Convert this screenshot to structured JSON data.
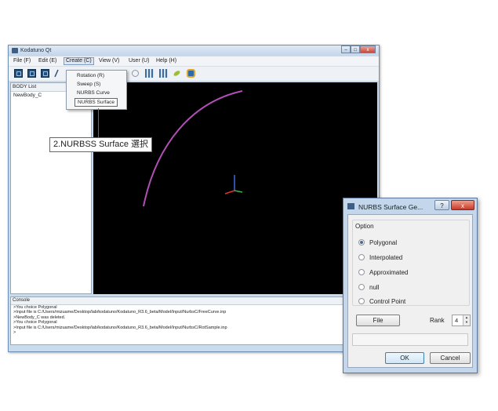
{
  "window": {
    "title": "Kodatuno Qt",
    "controls": [
      "–",
      "□",
      "x"
    ]
  },
  "menubar": {
    "items": [
      {
        "label": "File (F)"
      },
      {
        "label": "Edit (E)"
      },
      {
        "label": "Create (C)",
        "active": true
      },
      {
        "label": "View (V)"
      },
      {
        "label": "User (U)"
      },
      {
        "label": "Help (H)"
      }
    ]
  },
  "create_menu": {
    "items": [
      {
        "label": "Rotation (R)"
      },
      {
        "label": "Sweep (S)"
      },
      {
        "label": "NURBS Curve"
      },
      {
        "label": "NURBS Surface",
        "highlighted": true
      }
    ]
  },
  "body_list": {
    "header": "BODY List",
    "items": [
      "NewBody_C"
    ]
  },
  "console": {
    "header": "Console",
    "lines": [
      ">You choice Polygonal",
      ">Input file is C:/Users/mizuame/Desktop/lab/kodatuno/Kodatuno_R3.6_beta/Model/Input/NurbsC/FreeCurve.inp",
      ">NewBody_C was deleted.",
      ">You choice Polygonal",
      ">Input file is C:/Users/mizuame/Desktop/lab/kodatuno/Kodatuno_R3.6_beta/Model/Input/NurbsC/RotSample.inp",
      ">"
    ]
  },
  "annotation": {
    "text": "2.NURBSS Surface 選択",
    "color": "#d23a3a"
  },
  "dialog": {
    "title": "NURBS Surface Ge...",
    "help": "?",
    "close": "x",
    "option_label": "Option",
    "options": [
      {
        "label": "Polygonal",
        "selected": true
      },
      {
        "label": "Interpolated",
        "selected": false
      },
      {
        "label": "Approximated",
        "selected": false
      },
      {
        "label": "null",
        "selected": false
      },
      {
        "label": "Control Point",
        "selected": false
      }
    ],
    "file_button": "File",
    "rank_label": "Rank",
    "rank_value": "4",
    "ok_button": "OK",
    "cancel_button": "Cancel"
  },
  "viewport": {
    "curve_color": "#b24fb6",
    "axis_colors": {
      "x": "#e0302a",
      "y": "#3a6ae0",
      "z": "#36b24a"
    }
  }
}
